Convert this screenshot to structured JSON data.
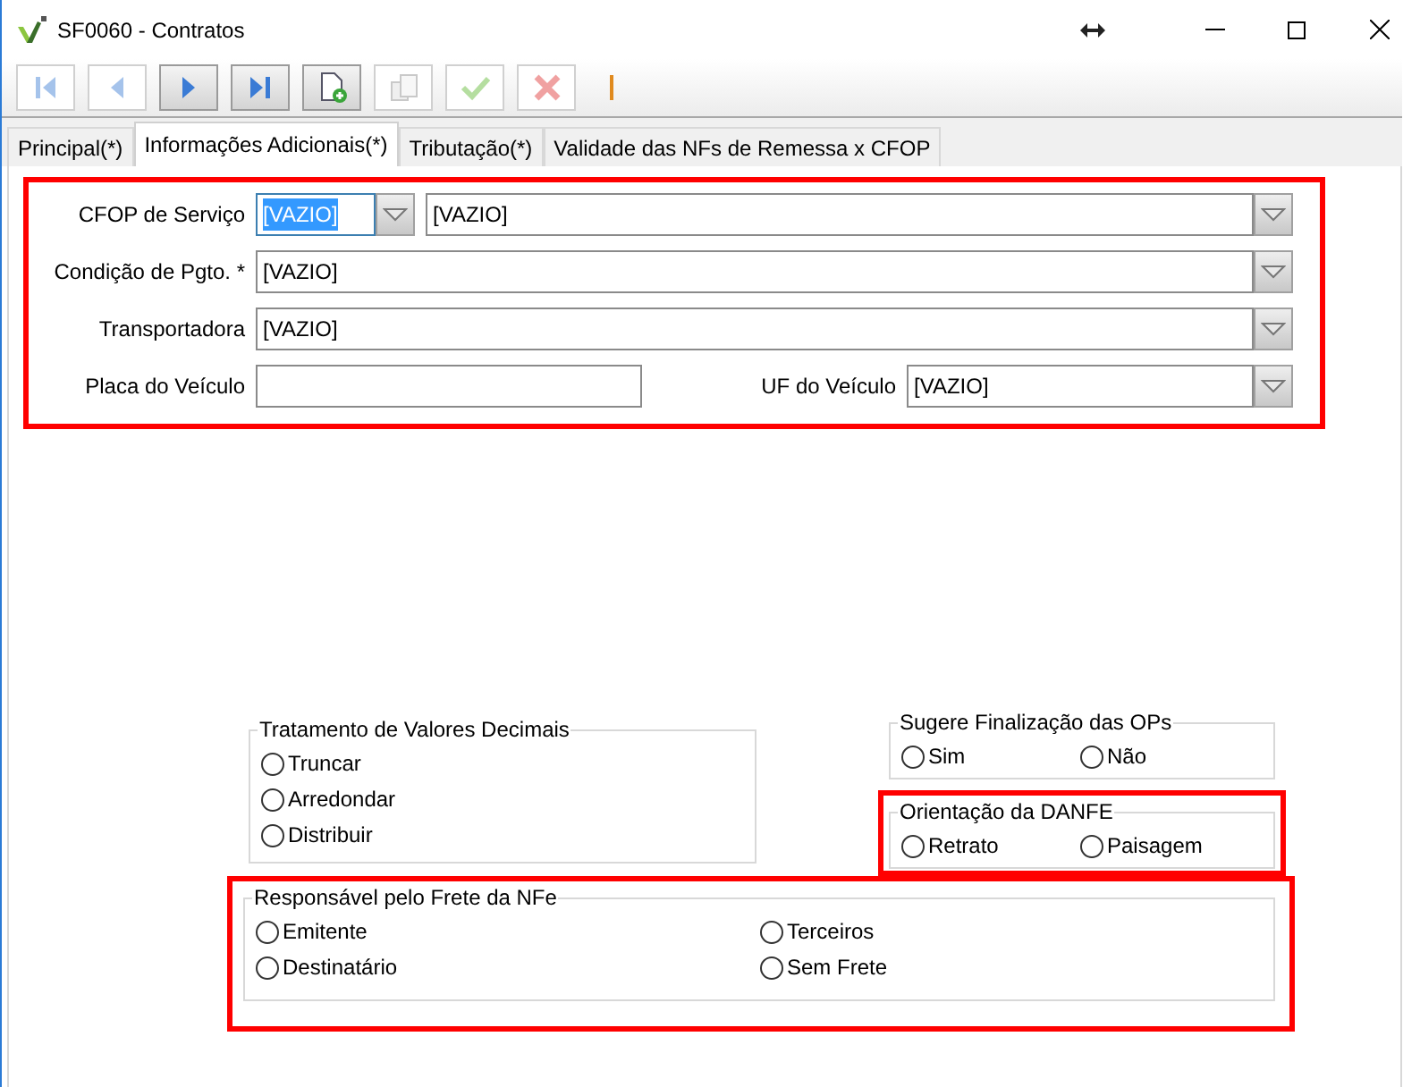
{
  "window": {
    "title": "SF0060 - Contratos"
  },
  "toolbar": [
    {
      "kind": "first",
      "disabled": true
    },
    {
      "kind": "previous",
      "disabled": true
    },
    {
      "kind": "next",
      "disabled": false
    },
    {
      "kind": "last",
      "disabled": false
    },
    {
      "kind": "new",
      "disabled": false
    },
    {
      "kind": "copy",
      "disabled": true
    },
    {
      "kind": "confirm",
      "disabled": true
    },
    {
      "kind": "cancel",
      "disabled": true
    }
  ],
  "tabs": [
    {
      "label": "Principal(*)",
      "selected": false
    },
    {
      "label": "Informações Adicionais(*)",
      "selected": true
    },
    {
      "label": "Tributação(*)",
      "selected": false
    },
    {
      "label": "Validade das NFs de Remessa x CFOP",
      "selected": false
    }
  ],
  "form": {
    "highlighted": true,
    "rows": [
      {
        "kind": "cfop",
        "label": "CFOP de Serviço",
        "code": "[VAZIO]",
        "code_focused": true,
        "description": "[VAZIO]"
      },
      {
        "kind": "combo",
        "label": "Condição de Pgto. *",
        "value": "[VAZIO]"
      },
      {
        "kind": "combo",
        "label": "Transportadora",
        "value": "[VAZIO]"
      },
      {
        "kind": "split",
        "label": "Placa do Veículo",
        "second_label": "UF do Veículo",
        "second_value": "[VAZIO]"
      }
    ]
  },
  "decimal_treatment": {
    "title": "Tratamento de Valores Decimais",
    "highlighted": false,
    "options": [
      {
        "label": "Truncar",
        "selected": false
      },
      {
        "label": "Arredondar",
        "selected": false
      },
      {
        "label": "Distribuir",
        "selected": false
      }
    ]
  },
  "op_completion": {
    "title": "Sugere Finalização das OPs",
    "highlighted": false,
    "options": [
      {
        "label": "Sim",
        "selected": false
      },
      {
        "label": "Não",
        "selected": false
      }
    ]
  },
  "danfe_orientation": {
    "title": "Orientação da DANFE",
    "highlighted": true,
    "options": [
      {
        "label": "Retrato",
        "selected": false
      },
      {
        "label": "Paisagem",
        "selected": false
      }
    ]
  },
  "freight": {
    "title": "Responsável pelo Frete da NFe",
    "highlighted": true,
    "options": [
      {
        "label": "Emitente",
        "selected": false
      },
      {
        "label": "Terceiros",
        "selected": false
      },
      {
        "label": "Destinatário",
        "selected": false
      },
      {
        "label": "Sem Frete",
        "selected": false
      }
    ]
  }
}
